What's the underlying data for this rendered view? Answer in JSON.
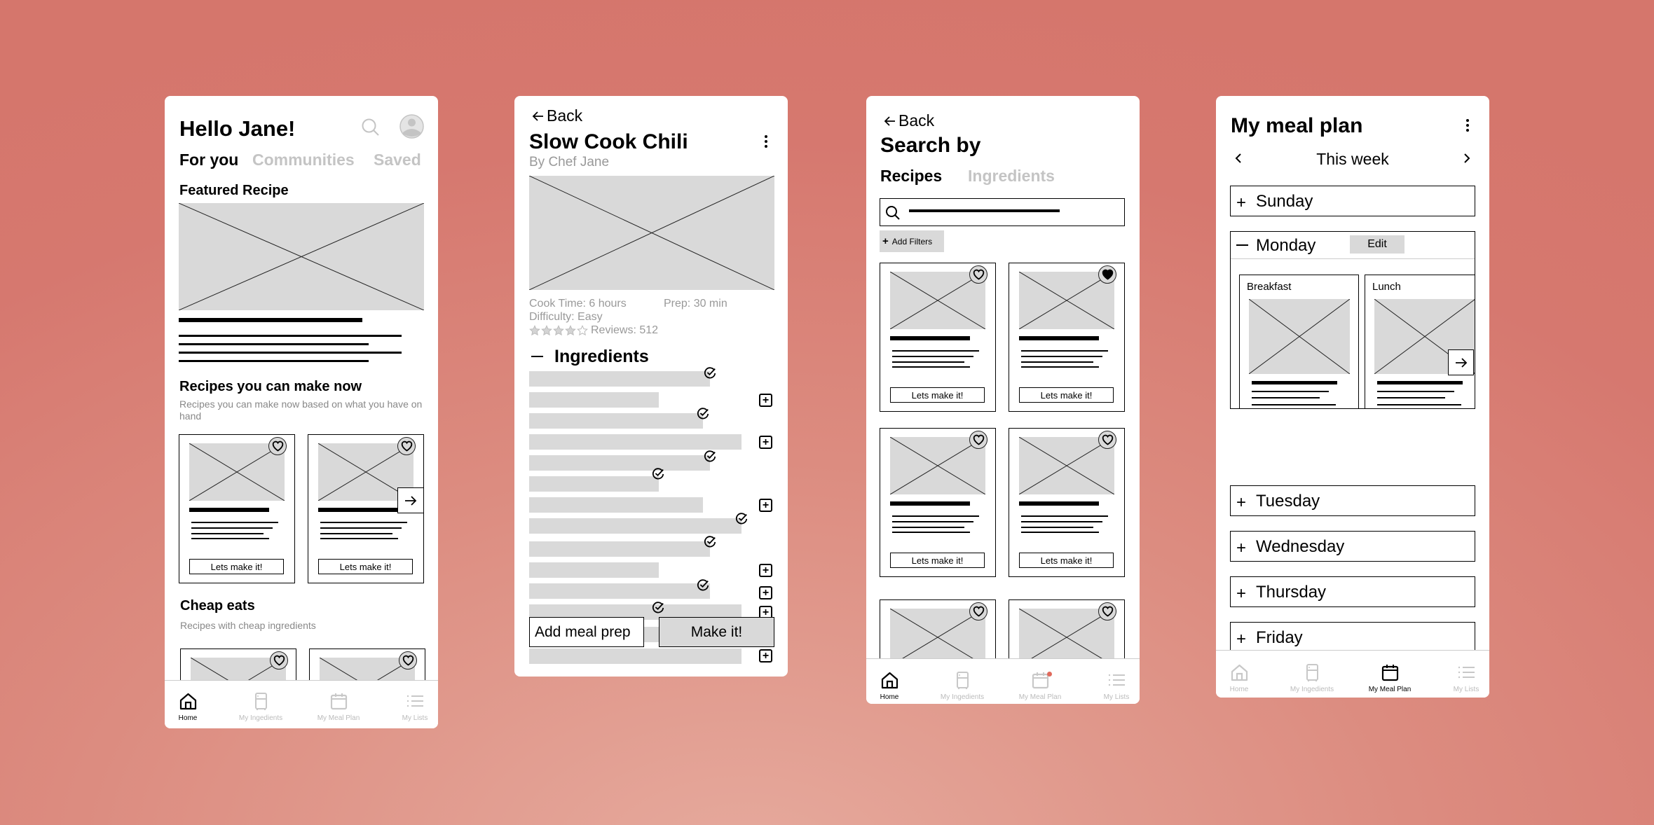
{
  "colors": {
    "background": "#d6786f",
    "placeholder": "#d9d9d9",
    "inactive_text": "#c4c4c4",
    "notification_dot": "#e06a5c"
  },
  "nav": {
    "items": [
      {
        "label": "Home",
        "icon": "home-icon"
      },
      {
        "label": "My Ingedients",
        "icon": "fridge-icon"
      },
      {
        "label": "My Meal Plan",
        "icon": "calendar-icon"
      },
      {
        "label": "My Lists",
        "icon": "list-icon"
      }
    ]
  },
  "home": {
    "greeting": "Hello Jane!",
    "tabs": [
      "For you",
      "Communities",
      "Saved"
    ],
    "active_tab": 0,
    "featured_title": "Featured Recipe",
    "make_now_title": "Recipes you can make now",
    "make_now_subtitle": "Recipes you can make now based on what you have on hand",
    "cheap_title": "Cheap eats",
    "cheap_subtitle": "Recipes with cheap ingredients",
    "card_button": "Lets make it!",
    "active_nav": 0
  },
  "recipe": {
    "back": "Back",
    "title": "Slow Cook Chili",
    "author": "By Chef Jane",
    "cook_time": "Cook Time: 6 hours",
    "prep": "Prep: 30 min",
    "difficulty": "Difficulty: Easy",
    "rating": 4,
    "rating_max": 5,
    "reviews": "Reviews: 512",
    "ingredients_title": "Ingredients",
    "add_meal_prep": "Add meal prep",
    "make_it": "Make it!"
  },
  "search": {
    "back": "Back",
    "title": "Search by",
    "tabs": [
      "Recipes",
      "Ingredients"
    ],
    "active_tab": 0,
    "add_filters": "Add Filters",
    "card_button": "Lets make it!",
    "favorites": [
      false,
      true,
      false,
      false,
      false,
      false
    ],
    "active_nav": 0,
    "nav_badge_on": "My Meal Plan"
  },
  "mealplan": {
    "title": "My meal plan",
    "week": "This week",
    "days": [
      "Sunday",
      "Monday",
      "Tuesday",
      "Wednesday",
      "Thursday",
      "Friday"
    ],
    "expanded_day": "Monday",
    "edit": "Edit",
    "meals": [
      "Breakfast",
      "Lunch"
    ],
    "see_more": "See more",
    "active_nav": 2
  }
}
